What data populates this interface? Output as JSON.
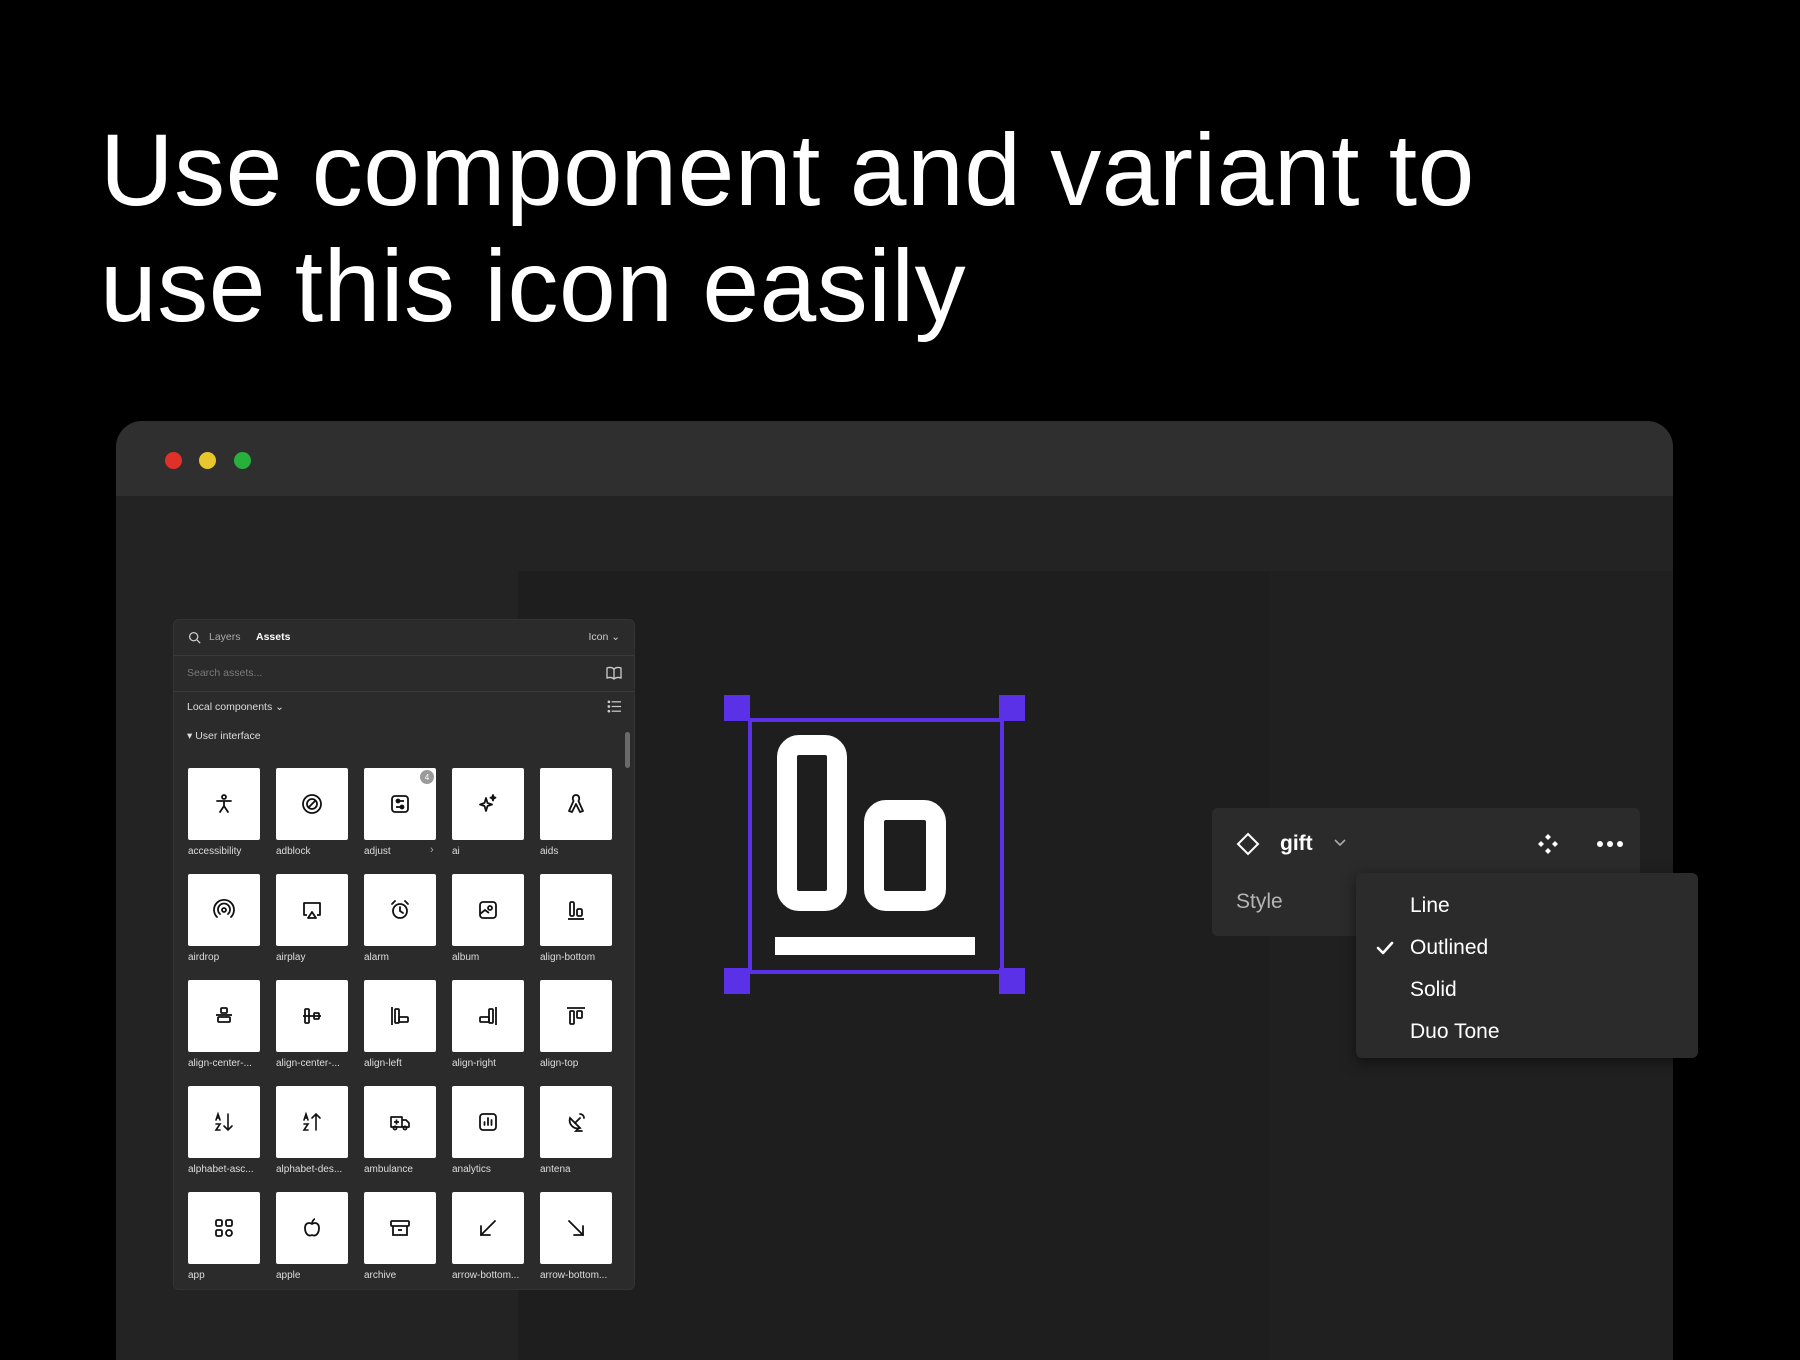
{
  "headline": {
    "line1": "Use component and variant to",
    "line2": "use this icon easily"
  },
  "window": {
    "controls": [
      "close",
      "minimize",
      "zoom"
    ],
    "colors": {
      "close": "#e0302a",
      "minimize": "#e8c72e",
      "zoom": "#27b03b"
    }
  },
  "assets_panel": {
    "tab_layers": "Layers",
    "tab_assets": "Assets",
    "library_select": "Icon ⌄",
    "search_placeholder": "Search assets...",
    "local_components": "Local components ⌄",
    "section": "▾ User interface",
    "tiles": [
      {
        "label": "accessibility",
        "icon": "accessibility-icon"
      },
      {
        "label": "adblock",
        "icon": "adblock-icon"
      },
      {
        "label": "adjust",
        "icon": "adjust-icon",
        "badge": "4"
      },
      {
        "label": "ai",
        "icon": "ai-sparkle-icon"
      },
      {
        "label": "aids",
        "icon": "aids-ribbon-icon"
      },
      {
        "label": "airdrop",
        "icon": "airdrop-icon"
      },
      {
        "label": "airplay",
        "icon": "airplay-icon"
      },
      {
        "label": "alarm",
        "icon": "alarm-icon"
      },
      {
        "label": "album",
        "icon": "album-icon"
      },
      {
        "label": "align-bottom",
        "icon": "align-bottom-icon"
      },
      {
        "label": "align-center-...",
        "icon": "align-center-horizontal-icon"
      },
      {
        "label": "align-center-...",
        "icon": "align-center-vertical-icon"
      },
      {
        "label": "align-left",
        "icon": "align-left-icon"
      },
      {
        "label": "align-right",
        "icon": "align-right-icon"
      },
      {
        "label": "align-top",
        "icon": "align-top-icon"
      },
      {
        "label": "alphabet-asc...",
        "icon": "alphabet-ascending-icon"
      },
      {
        "label": "alphabet-des...",
        "icon": "alphabet-descending-icon"
      },
      {
        "label": "ambulance",
        "icon": "ambulance-icon"
      },
      {
        "label": "analytics",
        "icon": "analytics-icon"
      },
      {
        "label": "antena",
        "icon": "antena-icon"
      },
      {
        "label": "app",
        "icon": "app-grid-icon"
      },
      {
        "label": "apple",
        "icon": "apple-icon"
      },
      {
        "label": "archive",
        "icon": "archive-icon"
      },
      {
        "label": "arrow-bottom...",
        "icon": "arrow-bottom-left-icon"
      },
      {
        "label": "arrow-bottom...",
        "icon": "arrow-bottom-right-icon"
      }
    ],
    "chevron": "›"
  },
  "canvas": {
    "selected_icon": "align-bottom-icon",
    "selection_color": "#5b31e8"
  },
  "properties": {
    "component_name": "gift",
    "style_label": "Style",
    "style_options": [
      {
        "label": "Line",
        "checked": false
      },
      {
        "label": "Outlined",
        "checked": true
      },
      {
        "label": "Solid",
        "checked": false
      },
      {
        "label": "Duo Tone",
        "checked": false
      }
    ]
  }
}
